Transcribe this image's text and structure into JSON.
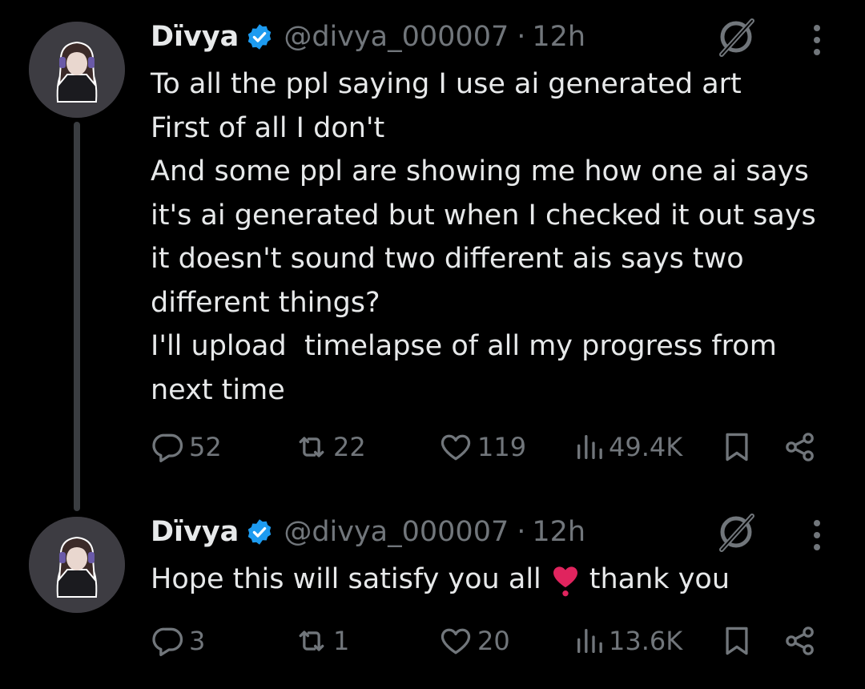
{
  "tweets": [
    {
      "author_name": "Dïvya",
      "handle": "@divya_000007",
      "separator": "·",
      "time": "12h",
      "lines": [
        "To all the ppl saying I use ai generated art",
        "First of all I don't",
        "And some ppl are showing me how one ai says",
        "it's ai generated but when I checked it out says",
        "it doesn't sound two different ais says two",
        "different things?",
        "I'll upload  timelapse of all my progress from",
        "next time"
      ],
      "stats": {
        "replies": "52",
        "reposts": "22",
        "likes": "119",
        "views": "49.4K"
      }
    },
    {
      "author_name": "Dïvya",
      "handle": "@divya_000007",
      "separator": "·",
      "time": "12h",
      "text_before_emoji": "Hope this will satisfy you all",
      "emoji": "heart-emoji",
      "text_after_emoji": "thank you",
      "stats": {
        "replies": "3",
        "reposts": "1",
        "likes": "20",
        "views": "13.6K"
      }
    }
  ],
  "colors": {
    "background": "#000000",
    "text": "#e7e9ea",
    "secondary": "#71767b",
    "verified": "#1d9bf0",
    "heart_emoji": "#e0245e"
  }
}
